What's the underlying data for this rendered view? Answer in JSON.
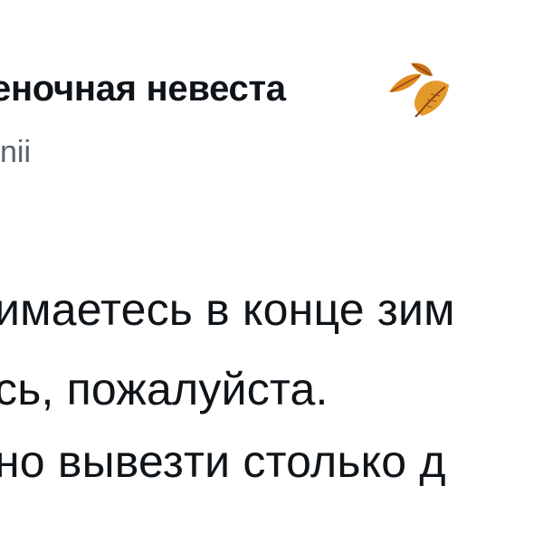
{
  "tweet": {
    "author": {
      "display_name": "еночная невеста",
      "emoji_icon": "fallen-leaf-icon",
      "handle": "nii"
    },
    "text_lines": [
      "имаетесь в конце зим",
      "сь, пожалуйста.",
      "но вывезти столько д"
    ]
  },
  "colors": {
    "text": "#0f1419",
    "secondary_text": "#536471",
    "background": "#ffffff",
    "leaf_orange": "#d9831f",
    "leaf_dark": "#9a4a12"
  }
}
